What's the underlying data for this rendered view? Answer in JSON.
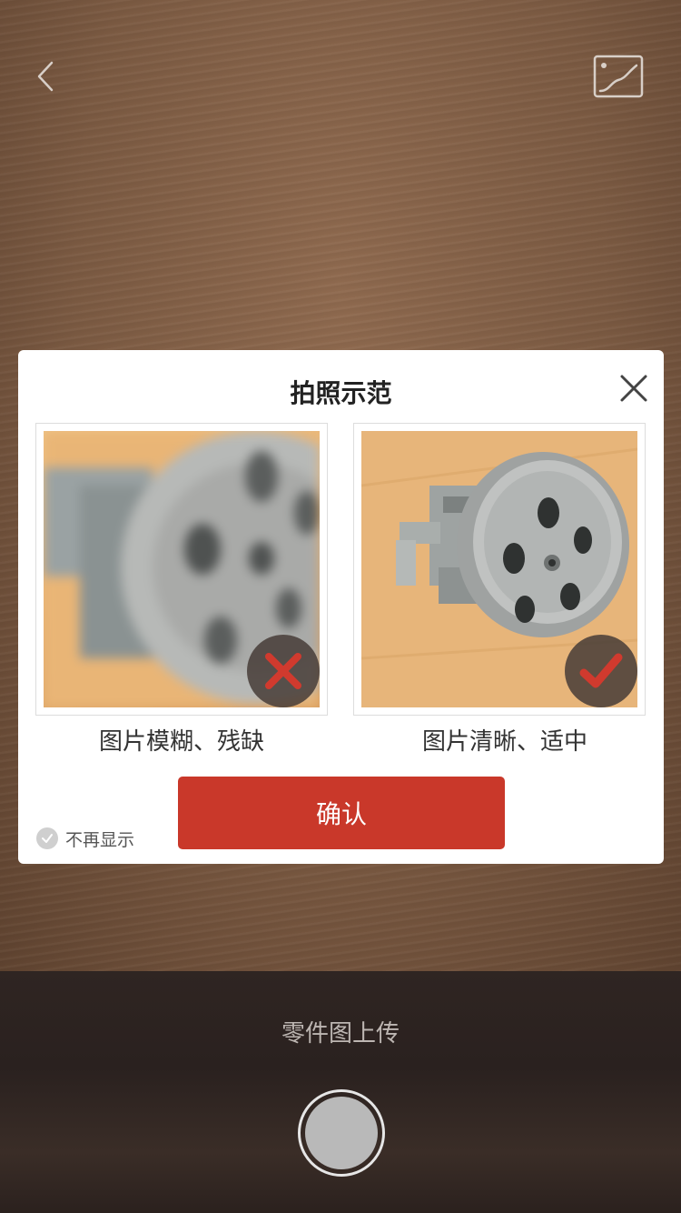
{
  "camera": {
    "back_icon": "chevron-left-icon",
    "album_icon": "gallery-icon"
  },
  "dialog": {
    "title": "拍照示范",
    "close_icon": "close-icon",
    "examples": [
      {
        "caption": "图片模糊、残缺",
        "status_icon": "x-mark-icon",
        "status_color": "#d03a2e"
      },
      {
        "caption": "图片清晰、适中",
        "status_icon": "check-mark-icon",
        "status_color": "#d03a2e"
      }
    ],
    "confirm_label": "确认",
    "dont_show_label": "不再显示"
  },
  "bottom": {
    "title": "零件图上传",
    "shutter_icon": "shutter-button-icon"
  },
  "colors": {
    "accent": "#c9382a",
    "dialog_bg": "#ffffff",
    "bottom_bar": "#2b211e"
  }
}
